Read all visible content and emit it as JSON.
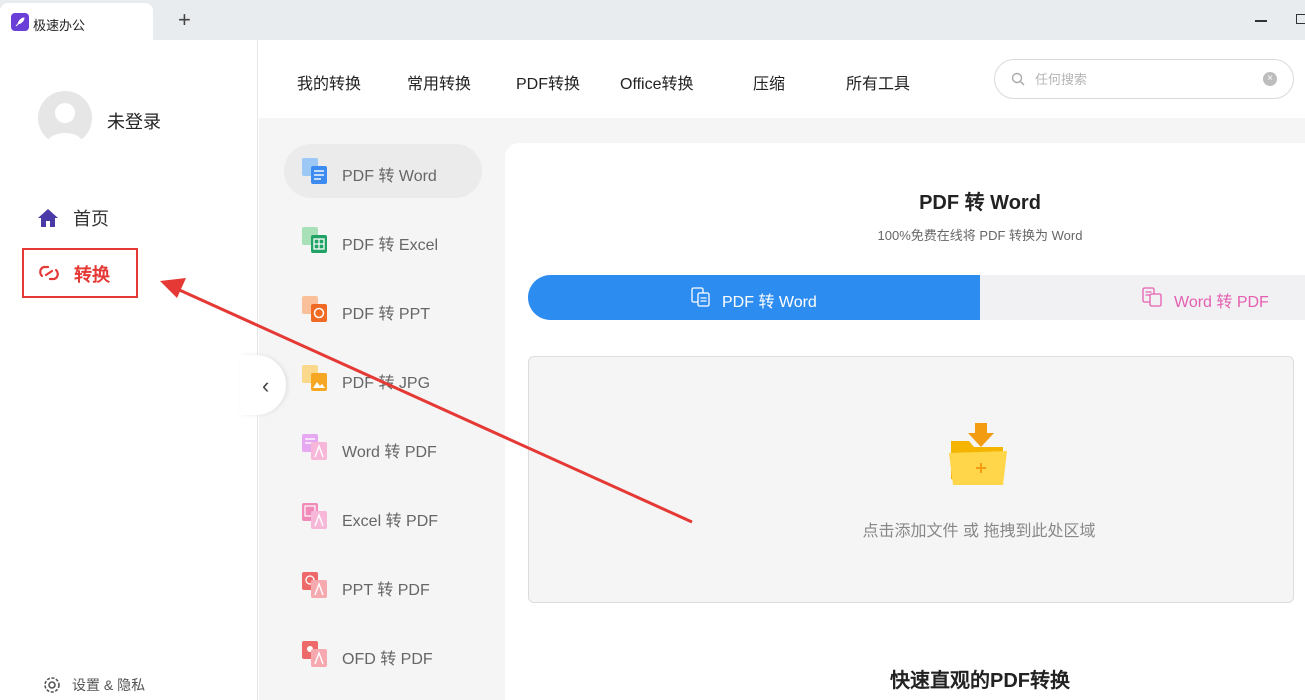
{
  "window": {
    "tab_title": "极速办公",
    "new_tab": "+"
  },
  "sidebar": {
    "user_name": "未登录",
    "nav": [
      {
        "label": "首页",
        "icon": "home-icon"
      },
      {
        "label": "转换",
        "icon": "convert-icon",
        "highlighted": true
      }
    ],
    "settings_label": "设置 & 隐私"
  },
  "topnav": {
    "items": [
      "我的转换",
      "常用转换",
      "PDF转换",
      "Office转换",
      "压缩",
      "所有工具"
    ],
    "search_placeholder": "任何搜索"
  },
  "tools": [
    {
      "label": "PDF 转 Word",
      "active": true
    },
    {
      "label": "PDF 转 Excel"
    },
    {
      "label": "PDF 转 PPT"
    },
    {
      "label": "PDF 转 JPG"
    },
    {
      "label": "Word 转 PDF"
    },
    {
      "label": "Excel 转 PDF"
    },
    {
      "label": "PPT 转 PDF"
    },
    {
      "label": "OFD 转 PDF"
    }
  ],
  "main": {
    "title": "PDF 转 Word",
    "subtitle": "100%免费在线将 PDF 转换为 Word",
    "tabs": [
      "PDF 转 Word",
      "Word 转 PDF"
    ],
    "drop_hint": "点击添加文件 或 拖拽到此处区域",
    "bottom_heading": "快速直观的PDF转换"
  },
  "colors": {
    "accent": "#2d8cf0",
    "highlight": "#e53935",
    "nav_home": "#4a3aa8",
    "word_pdf": "#e55fb0"
  }
}
